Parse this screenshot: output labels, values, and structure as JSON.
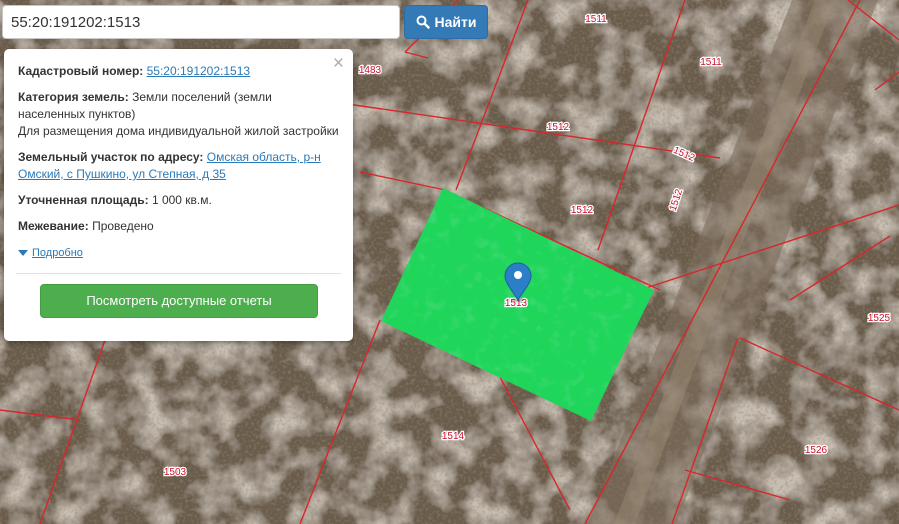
{
  "search": {
    "value": "55:20:191202:1513",
    "button_label": "Найти"
  },
  "popup": {
    "cadastral_label": "Кадастровый номер:",
    "cadastral_value": "55:20:191202:1513",
    "category_label": "Категория земель:",
    "category_value": "Земли поселений (земли населенных пунктов)",
    "purpose": "Для размещения дома индивидуальной жилой застройки",
    "address_label": "Земельный участок по адресу:",
    "address_value": "Омская область, р-н Омский, с Пушкино, ул Степная, д 35",
    "area_label": "Уточненная площадь:",
    "area_value": "1 000 кв.м.",
    "survey_label": "Межевание:",
    "survey_value": "Проведено",
    "details_link": "Подробно",
    "reports_button": "Посмотреть доступные отчеты",
    "close_symbol": "×"
  },
  "map": {
    "parcel_labels": [
      "1511",
      "1511",
      "1483",
      "1512",
      "1512",
      "1512",
      "1512",
      "1513",
      "1525",
      "1514",
      "1526",
      "1503"
    ],
    "colors": {
      "parcel_fill": "#1fd65a",
      "boundary": "#d8262c",
      "label_text": "#c8102e",
      "marker": "#2c7fc6"
    },
    "icons": [
      "search-icon",
      "map-marker-icon",
      "close-icon"
    ]
  }
}
